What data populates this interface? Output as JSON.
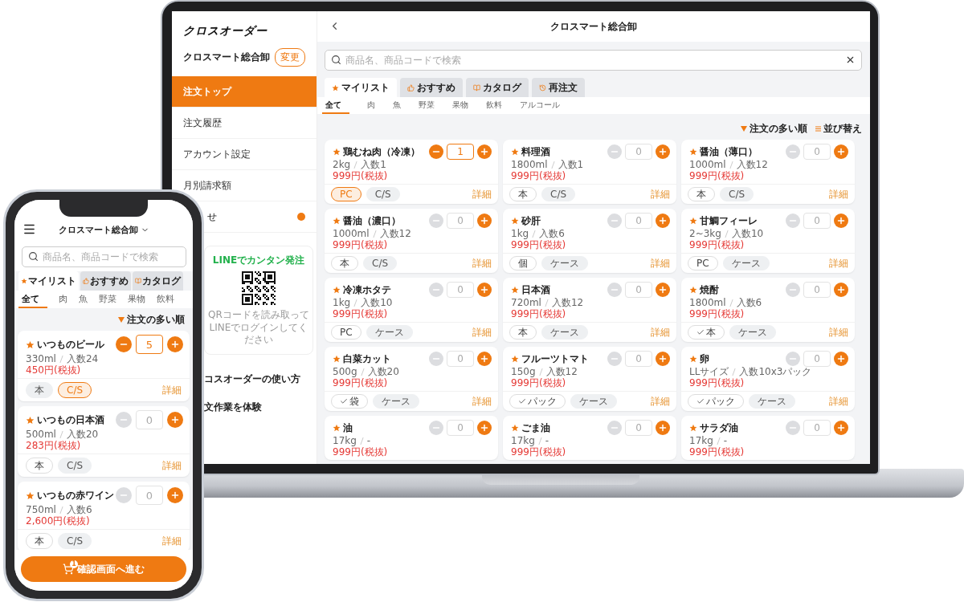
{
  "laptop": {
    "sidebar": {
      "logo": "クロスオーダー",
      "store": "クロスマート総合卸",
      "change_button": "変更",
      "menu": [
        {
          "label": "注文トップ",
          "selected": true
        },
        {
          "label": "注文履歴",
          "selected": false
        },
        {
          "label": "アカウント設定",
          "selected": false
        },
        {
          "label": "月別請求額",
          "selected": false
        }
      ],
      "notice": {
        "label": "せ",
        "unread": true
      },
      "line_card": {
        "title": "LINEでカンタン発注",
        "caption": "QRコードを読み取って\nLINEでログインしてください"
      },
      "links": [
        "コスオーダーの使い方",
        "文作業を体験"
      ]
    },
    "header": {
      "title": "クロスマート総合卸"
    },
    "search": {
      "placeholder": "商品名、商品コードで検索"
    },
    "tabs": [
      {
        "kind": "mylist",
        "label": "マイリスト",
        "selected": true
      },
      {
        "kind": "recommended",
        "label": "おすすめ",
        "selected": false
      },
      {
        "kind": "catalog",
        "label": "カタログ",
        "selected": false
      },
      {
        "kind": "reorder",
        "label": "再注文",
        "selected": false
      }
    ],
    "categories": [
      {
        "label": "全て",
        "selected": true
      },
      {
        "label": "肉",
        "selected": false
      },
      {
        "label": "魚",
        "selected": false
      },
      {
        "label": "野菜",
        "selected": false
      },
      {
        "label": "果物",
        "selected": false
      },
      {
        "label": "飲料",
        "selected": false
      },
      {
        "label": "アルコール",
        "selected": false
      }
    ],
    "sort": {
      "order": "注文の多い順",
      "sort_button": "並び替え"
    },
    "products": [
      {
        "name": "鶏むね肉（冷凍）",
        "spec": "2kg",
        "count": "入数1",
        "price": "999円(税抜)",
        "quantity": "1",
        "in_cart": true,
        "units": [
          {
            "label": "PC",
            "selected": true,
            "outlined": true,
            "checked": false
          },
          {
            "label": "C/S",
            "selected": false,
            "outlined": false,
            "checked": false
          }
        ],
        "detail": "詳細"
      },
      {
        "name": "料理酒",
        "spec": "1800ml",
        "count": "入数1",
        "price": "999円(税抜)",
        "quantity": "0",
        "in_cart": false,
        "units": [
          {
            "label": "本",
            "selected": false,
            "outlined": true,
            "checked": false
          },
          {
            "label": "C/S",
            "selected": false,
            "outlined": false,
            "checked": false
          }
        ],
        "detail": "詳細"
      },
      {
        "name": "醤油（薄口）",
        "spec": "1000ml",
        "count": "入数12",
        "price": "999円(税抜)",
        "quantity": "0",
        "in_cart": false,
        "units": [
          {
            "label": "本",
            "selected": false,
            "outlined": true,
            "checked": false
          },
          {
            "label": "C/S",
            "selected": false,
            "outlined": false,
            "checked": false
          }
        ],
        "detail": "詳細"
      },
      {
        "name": "醤油（濃口）",
        "spec": "1000ml",
        "count": "入数12",
        "price": "999円(税抜)",
        "quantity": "0",
        "in_cart": false,
        "units": [
          {
            "label": "本",
            "selected": false,
            "outlined": true,
            "checked": false
          },
          {
            "label": "C/S",
            "selected": false,
            "outlined": false,
            "checked": false
          }
        ],
        "detail": "詳細"
      },
      {
        "name": "砂肝",
        "spec": "1kg",
        "count": "入数6",
        "price": "999円(税抜)",
        "quantity": "0",
        "in_cart": false,
        "units": [
          {
            "label": "個",
            "selected": false,
            "outlined": true,
            "checked": false
          },
          {
            "label": "ケース",
            "selected": false,
            "outlined": false,
            "checked": false
          }
        ],
        "detail": "詳細"
      },
      {
        "name": "甘鯛フィーレ",
        "spec": "2~3kg",
        "count": "入数10",
        "price": "999円(税抜)",
        "quantity": "0",
        "in_cart": false,
        "units": [
          {
            "label": "PC",
            "selected": false,
            "outlined": true,
            "checked": false
          },
          {
            "label": "ケース",
            "selected": false,
            "outlined": false,
            "checked": false
          }
        ],
        "detail": "詳細"
      },
      {
        "name": "冷凍ホタテ",
        "spec": "1kg",
        "count": "入数10",
        "price": "999円(税抜)",
        "quantity": "0",
        "in_cart": false,
        "units": [
          {
            "label": "PC",
            "selected": false,
            "outlined": true,
            "checked": false
          },
          {
            "label": "ケース",
            "selected": false,
            "outlined": false,
            "checked": false
          }
        ],
        "detail": "詳細"
      },
      {
        "name": "日本酒",
        "spec": "720ml",
        "count": "入数12",
        "price": "999円(税抜)",
        "quantity": "0",
        "in_cart": false,
        "units": [
          {
            "label": "本",
            "selected": false,
            "outlined": true,
            "checked": false
          },
          {
            "label": "ケース",
            "selected": false,
            "outlined": false,
            "checked": false
          }
        ],
        "detail": "詳細"
      },
      {
        "name": "焼酎",
        "spec": "1800ml",
        "count": "入数6",
        "price": "999円(税抜)",
        "quantity": "0",
        "in_cart": false,
        "units": [
          {
            "label": "本",
            "selected": false,
            "outlined": true,
            "checked": true
          },
          {
            "label": "ケース",
            "selected": false,
            "outlined": false,
            "checked": false
          }
        ],
        "detail": "詳細"
      },
      {
        "name": "白菜カット",
        "spec": "500g",
        "count": "入数20",
        "price": "999円(税抜)",
        "quantity": "0",
        "in_cart": false,
        "units": [
          {
            "label": "袋",
            "selected": false,
            "outlined": true,
            "checked": true
          },
          {
            "label": "ケース",
            "selected": false,
            "outlined": false,
            "checked": false
          }
        ],
        "detail": "詳細"
      },
      {
        "name": "フルーツトマト",
        "spec": "150g",
        "count": "入数12",
        "price": "999円(税抜)",
        "quantity": "0",
        "in_cart": false,
        "units": [
          {
            "label": "パック",
            "selected": false,
            "outlined": true,
            "checked": true
          },
          {
            "label": "ケース",
            "selected": false,
            "outlined": false,
            "checked": false
          }
        ],
        "detail": "詳細"
      },
      {
        "name": "卵",
        "spec": "LLサイズ",
        "count": "入数10x3パック",
        "price": "999円(税抜)",
        "quantity": "0",
        "in_cart": false,
        "units": [
          {
            "label": "パック",
            "selected": false,
            "outlined": true,
            "checked": true
          },
          {
            "label": "ケース",
            "selected": false,
            "outlined": false,
            "checked": false
          }
        ],
        "detail": "詳細"
      },
      {
        "name": "油",
        "spec": "17kg",
        "count": "-",
        "price": "999円(税抜)",
        "quantity": "0",
        "in_cart": false
      },
      {
        "name": "ごま油",
        "spec": "17kg",
        "count": "-",
        "price": "999円(税抜)",
        "quantity": "0",
        "in_cart": false
      },
      {
        "name": "サラダ油",
        "spec": "17kg",
        "count": "-",
        "price": "999円(税抜)",
        "quantity": "0",
        "in_cart": false
      }
    ]
  },
  "phone": {
    "header": {
      "title": "クロスマート総合卸"
    },
    "search": {
      "placeholder": "商品名、商品コードで検索"
    },
    "tabs": [
      {
        "kind": "mylist",
        "label": "マイリスト",
        "selected": true
      },
      {
        "kind": "recommended",
        "label": "おすすめ",
        "selected": false
      },
      {
        "kind": "catalog",
        "label": "カタログ",
        "selected": false
      }
    ],
    "categories": [
      {
        "label": "全て",
        "selected": true
      },
      {
        "label": "肉",
        "selected": false
      },
      {
        "label": "魚",
        "selected": false
      },
      {
        "label": "野菜",
        "selected": false
      },
      {
        "label": "果物",
        "selected": false
      },
      {
        "label": "飲料",
        "selected": false
      }
    ],
    "sort": {
      "order": "注文の多い順"
    },
    "products": [
      {
        "name": "いつものビール",
        "spec": "330ml",
        "count": "入数24",
        "price": "450円(税抜)",
        "quantity": "5",
        "in_cart": true,
        "units": [
          {
            "label": "本",
            "selected": false,
            "outlined": false,
            "checked": false
          },
          {
            "label": "C/S",
            "selected": true,
            "outlined": true,
            "checked": false
          }
        ],
        "detail": "詳細"
      },
      {
        "name": "いつもの日本酒",
        "spec": "500ml",
        "count": "入数20",
        "price": "283円(税抜)",
        "quantity": "0",
        "in_cart": false,
        "units": [
          {
            "label": "本",
            "selected": false,
            "outlined": true,
            "checked": false
          },
          {
            "label": "C/S",
            "selected": false,
            "outlined": false,
            "checked": false
          }
        ],
        "detail": "詳細"
      },
      {
        "name": "いつもの赤ワイン",
        "spec": "750ml",
        "count": "入数6",
        "price": "2,600円(税抜)",
        "quantity": "0",
        "in_cart": false,
        "units": [
          {
            "label": "本",
            "selected": false,
            "outlined": true,
            "checked": false
          },
          {
            "label": "C/S",
            "selected": false,
            "outlined": false,
            "checked": false
          }
        ],
        "detail": "詳細"
      }
    ],
    "checkout": {
      "label": "確認画面へ進む",
      "cart_count": "1"
    }
  }
}
